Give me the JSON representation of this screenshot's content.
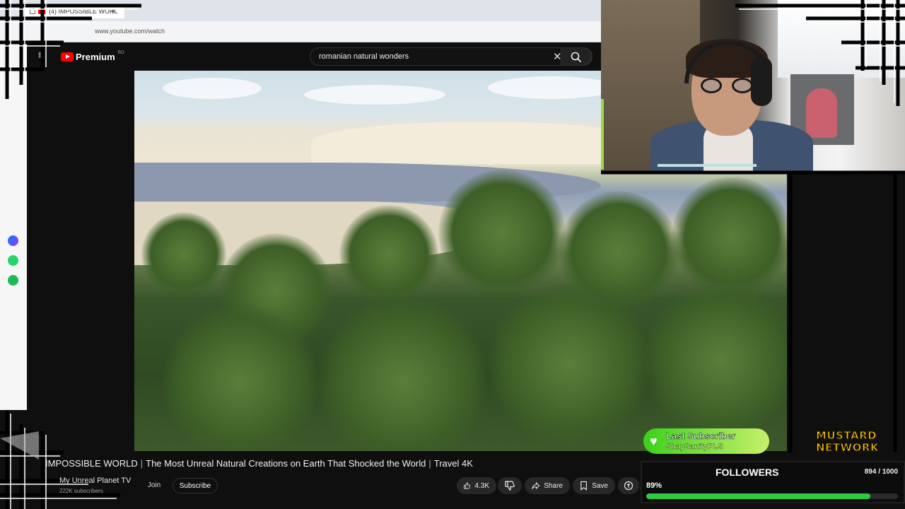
{
  "browser": {
    "tab_label": "(4) IMPOSSIBLE WORL",
    "new_tab": "+",
    "url": "www.youtube.com/watch"
  },
  "youtube": {
    "logo_text": "Premium",
    "region": "RO",
    "search_value": "romanian natural wonders"
  },
  "video": {
    "channel_tag": "IMPOSSIBLE WORLD",
    "title": "The Most Unreal Natural Creations on Earth That Shocked the World",
    "title_suffix": "Travel 4K",
    "channel_name": "My Unreal Planet TV",
    "subscribers": "222K subscribers",
    "join_label": "Join",
    "subscribe_label": "Subscribe",
    "likes": "4.3K",
    "share_label": "Share",
    "save_label": "Save"
  },
  "overlay": {
    "last_subscriber_title": "Last Subscriber",
    "last_subscriber_name": "ShaySanityPLS",
    "brand_line1": "MUSTARD",
    "brand_line2": "NETWORK",
    "followers_title": "FOLLOWERS",
    "followers_count": "894 / 1000",
    "followers_percent_label": "89%",
    "followers_progress": 0.89,
    "progress_color": "#2ecc40",
    "accent_green": "#3ad11c"
  },
  "icons": {
    "sidebar": [
      "messenger-icon",
      "whatsapp-icon",
      "spotify-icon"
    ],
    "search": "search-icon",
    "clear": "close-icon",
    "like": "thumbs-up-icon",
    "dislike": "thumbs-down-icon",
    "share": "share-arrow-icon",
    "save": "bookmark-icon",
    "heart": "heart-icon"
  }
}
